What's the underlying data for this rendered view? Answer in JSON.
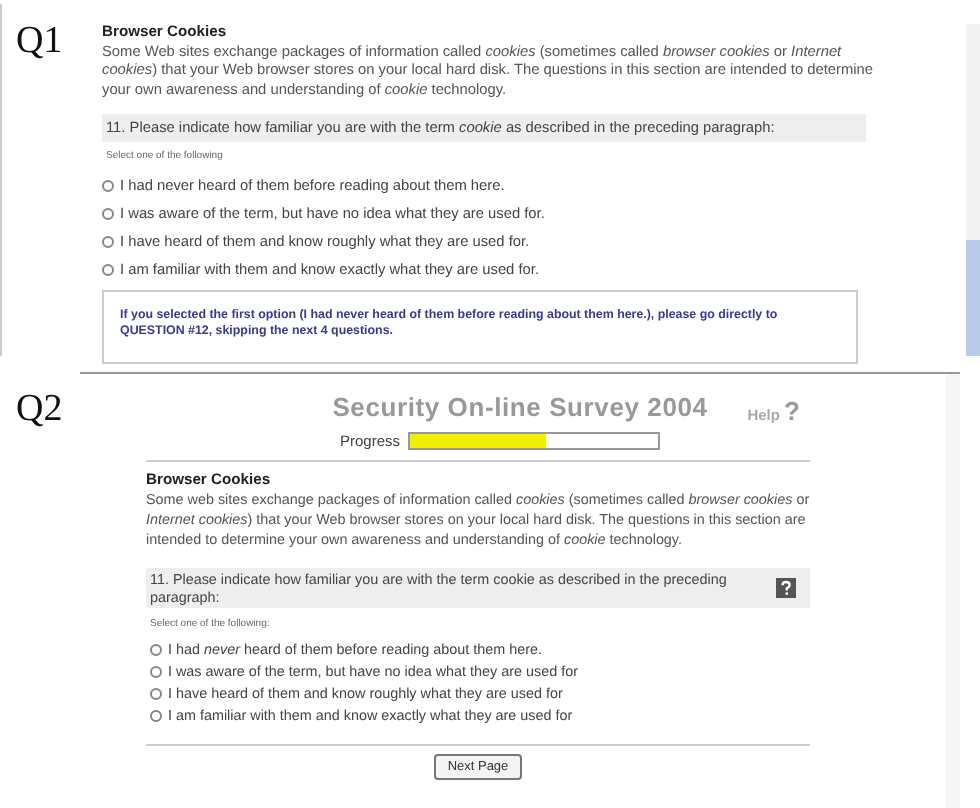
{
  "q1": {
    "label": "Q1",
    "section_title": "Browser Cookies",
    "intro": "Some Web sites exchange packages of information called *cookies* (sometimes called *browser cookies* or *Internet cookies*) that your Web browser stores on your local hard disk. The questions in this section are intended to determine your own awareness and understanding of *cookie* technology.",
    "question": "11. Please indicate how familiar you are with the term *cookie* as described in the preceding paragraph:",
    "instruction": "Select one of the following",
    "options": [
      {
        "text": "I had never heard of them before reading about them here.",
        "selected": false
      },
      {
        "text": "I was aware of the term, but have no idea what they are used for.",
        "selected": false
      },
      {
        "text": "I have heard of them and know roughly what they are used for.",
        "selected": false
      },
      {
        "text": "I am familiar with them and know exactly what they are used for.",
        "selected": false
      }
    ],
    "note": "If you selected the first option (I had never heard of them before reading about them here.), please go directly to QUESTION #12, skipping the next 4 questions."
  },
  "q2": {
    "label": "Q2",
    "survey_title": "Security On-line Survey 2004",
    "help_label": "Help",
    "help_mark": "?",
    "progress": {
      "label": "Progress",
      "level": 0.55
    },
    "section_title": "Browser Cookies",
    "intro": "Some web sites exchange packages of information called *cookies* (sometimes called *browser cookies* or *Internet cookies*) that your Web browser stores on your local hard disk. The questions in this section are intended to determine your own awareness and understanding of *cookie* technology.",
    "question": "11. Please indicate how familiar you are with the term cookie as described in the preceding paragraph:",
    "instruction": "Select one of the following:",
    "options": [
      {
        "text": "I had *never* heard of them before reading about them here.",
        "selected": false
      },
      {
        "text": "I was aware of the term, but have no idea what they are used for",
        "selected": false
      },
      {
        "text": "I have heard of them and know roughly what they are used for",
        "selected": false
      },
      {
        "text": "I am familiar with them and know exactly what they are used for",
        "selected": false
      }
    ],
    "next_button": "Next Page"
  }
}
